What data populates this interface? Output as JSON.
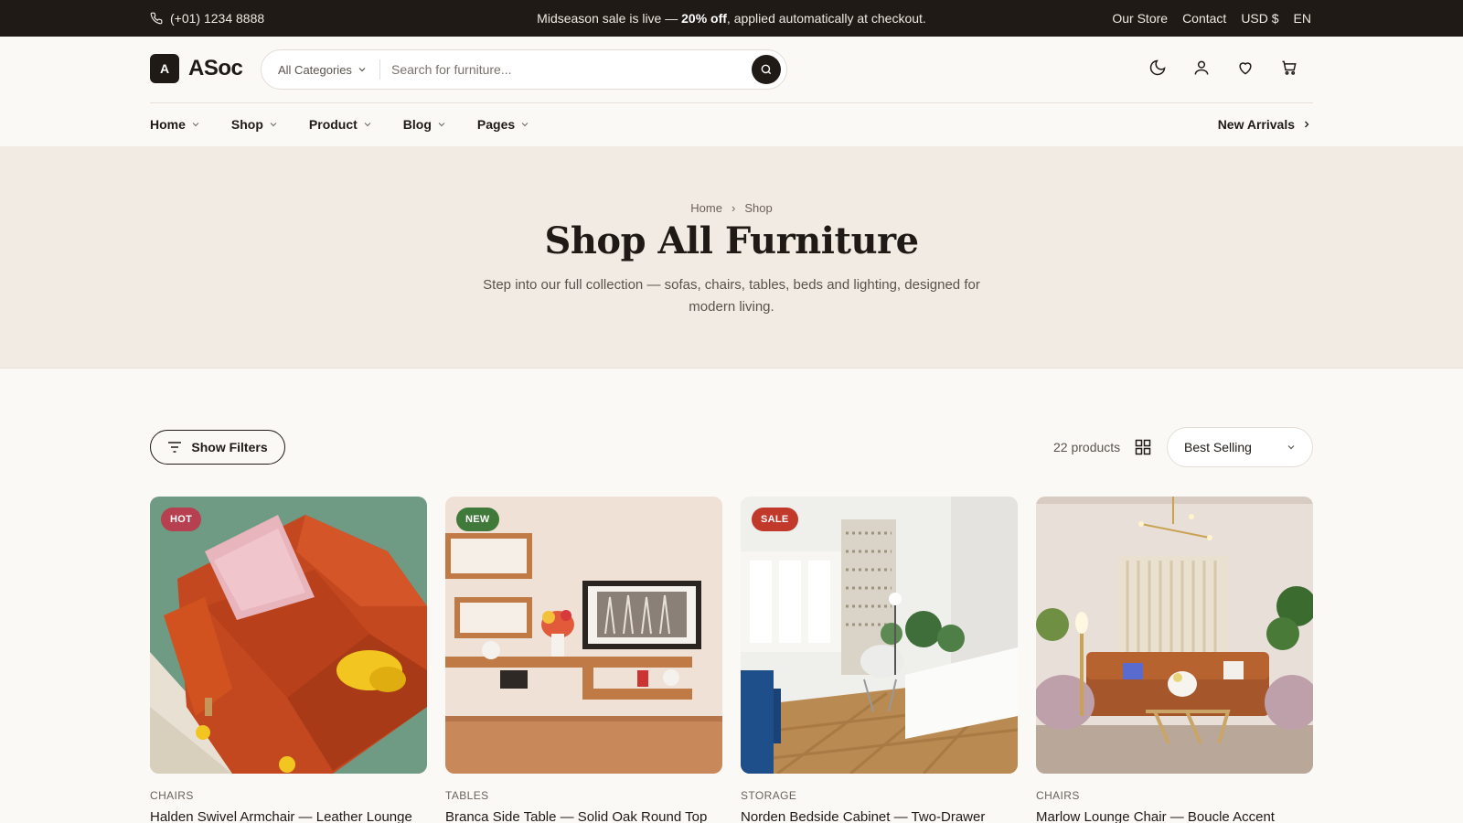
{
  "topbar": {
    "phone": "(+01) 1234 8888",
    "promo_prefix": "Midseason sale is live — ",
    "promo_bold": "20% off",
    "promo_suffix": ", applied automatically at checkout.",
    "links": [
      "Our Store",
      "Contact",
      "USD $",
      "EN"
    ]
  },
  "header": {
    "logo_mark": "A",
    "logo_name": "ASoc",
    "search_category": "All Categories",
    "search_placeholder": "Search for furniture..."
  },
  "nav": {
    "items": [
      "Home",
      "Shop",
      "Product",
      "Blog",
      "Pages"
    ],
    "new_arrivals": "New Arrivals"
  },
  "hero": {
    "breadcrumb": [
      "Home",
      "Shop"
    ],
    "title": "Shop All Furniture",
    "subtitle": "Step into our full collection — sofas, chairs, tables, beds and lighting, designed for modern living."
  },
  "toolbar": {
    "filters_label": "Show Filters",
    "count": "22 products",
    "sort_value": "Best Selling"
  },
  "colors": {
    "hot": "#b6404f",
    "new": "#3f7a3a",
    "sale": "#c0392b"
  },
  "products": [
    {
      "badge": "HOT",
      "category": "CHAIRS",
      "title": "Halden Swivel Armchair — Leather Lounge"
    },
    {
      "badge": "NEW",
      "category": "TABLES",
      "title": "Branca Side Table — Solid Oak Round Top"
    },
    {
      "badge": "SALE",
      "category": "STORAGE",
      "title": "Norden Bedside Cabinet — Two-Drawer"
    },
    {
      "badge": "",
      "category": "CHAIRS",
      "title": "Marlow Lounge Chair — Boucle Accent"
    }
  ]
}
